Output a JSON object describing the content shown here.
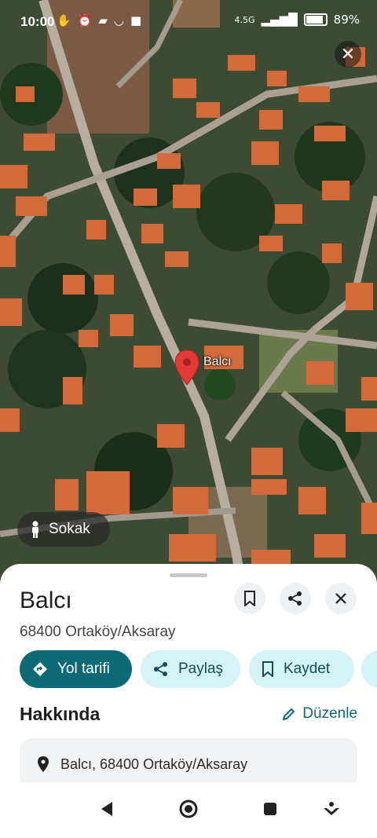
{
  "status_bar": {
    "time": "10:00",
    "network": "4.5G",
    "battery_percent": "89%",
    "battery_level": 0.89
  },
  "map": {
    "pin_label": "Balcı",
    "street_view_label": "Sokak"
  },
  "place": {
    "title": "Balcı",
    "address_short": "68400 Ortaköy/Aksaray",
    "actions": {
      "directions": "Yol tarifi",
      "share": "Paylaş",
      "save": "Kaydet"
    },
    "about": {
      "heading": "Hakkında",
      "edit": "Düzenle",
      "address": "Balcı, 68400 Ortaköy/Aksaray"
    }
  },
  "colors": {
    "primary": "#0b6a75",
    "chip_light": "#d5f2f7",
    "pin": "#e53935"
  }
}
